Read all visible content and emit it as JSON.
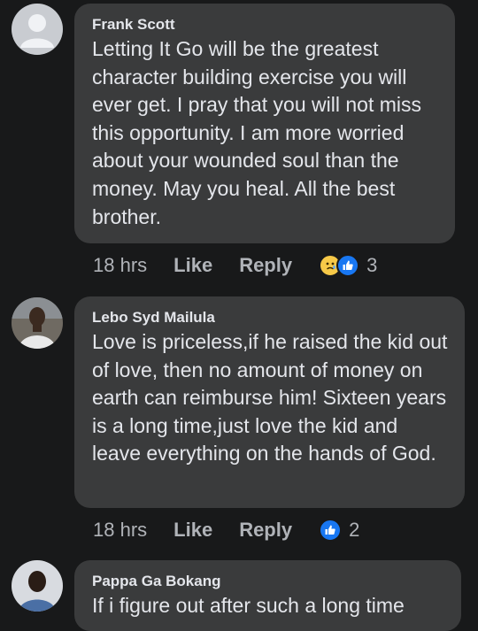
{
  "comments": [
    {
      "author": "Frank Scott",
      "text": "Letting It Go will be the greatest character building exercise you will ever get. I pray that you will not miss this opportunity. I am more worried about your wounded soul than the money. May you heal. All the best brother.",
      "time": "18 hrs",
      "like_label": "Like",
      "reply_label": "Reply",
      "reactions": [
        "sad",
        "like"
      ],
      "reaction_count": "3"
    },
    {
      "author": "Lebo Syd Mailula",
      "text": "Love is priceless,if he raised the kid out of love, then no amount of money on earth can reimburse him! Sixteen years is a long time,just love the kid and leave everything on the hands of God.",
      "time": "18 hrs",
      "like_label": "Like",
      "reply_label": "Reply",
      "reactions": [
        "like"
      ],
      "reaction_count": "2"
    },
    {
      "author": "Pappa Ga Bokang",
      "text": "If i figure out after such a long time"
    }
  ],
  "colors": {
    "background": "#18191a",
    "bubble": "#3a3b3c",
    "text": "#e4e6eb",
    "meta": "#b0b3b8",
    "like_blue": "#1877f2",
    "sad_yellow": "#f7c948"
  }
}
